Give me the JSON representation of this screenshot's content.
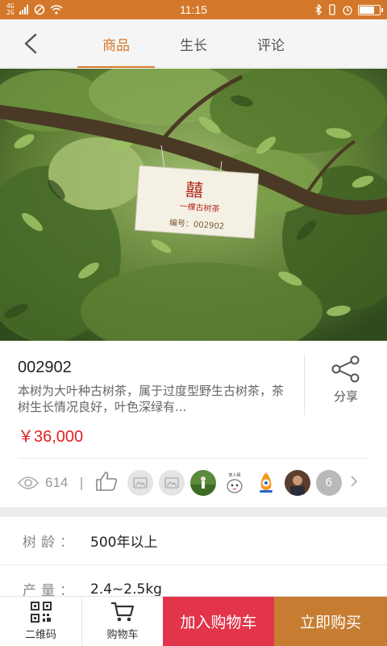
{
  "status_bar": {
    "network_left": "4G",
    "network_right": "2G",
    "time": "11:15"
  },
  "nav": {
    "tabs": [
      {
        "label": "商品",
        "active": true
      },
      {
        "label": "生长",
        "active": false
      },
      {
        "label": "评论",
        "active": false
      }
    ]
  },
  "hero": {
    "sign_text_top": "一棵古树茶",
    "sign_text_bottom": "编号：002902"
  },
  "product": {
    "code": "002902",
    "description": "本树为大叶种古树茶，属于过度型野生古树茶，茶树生长情况良好，叶色深绿有...",
    "price": "￥36,000",
    "share_label": "分享"
  },
  "stats": {
    "views": "614",
    "separator": "|",
    "avatar_more_count": "6",
    "avatar_badge_text": "茶人网"
  },
  "attributes": [
    {
      "label": "树龄：",
      "value": "500年以上"
    },
    {
      "label": "产量：",
      "value": "2.4~2.5kg"
    }
  ],
  "bottom_bar": {
    "qrcode_label": "二维码",
    "cart_label": "购物车",
    "add_to_cart": "加入购物车",
    "buy_now": "立即购买"
  },
  "colors": {
    "accent": "#d3782a",
    "price": "#e02020",
    "add_to_cart_bg": "#e2344a",
    "buy_now_bg": "#c67d32"
  },
  "icons": [
    "back-chevron-icon",
    "share-icon",
    "eye-icon",
    "thumbs-up-icon",
    "qrcode-icon",
    "cart-icon",
    "chevron-right-icon",
    "wifi-icon",
    "bluetooth-icon",
    "alarm-icon",
    "battery-icon"
  ]
}
